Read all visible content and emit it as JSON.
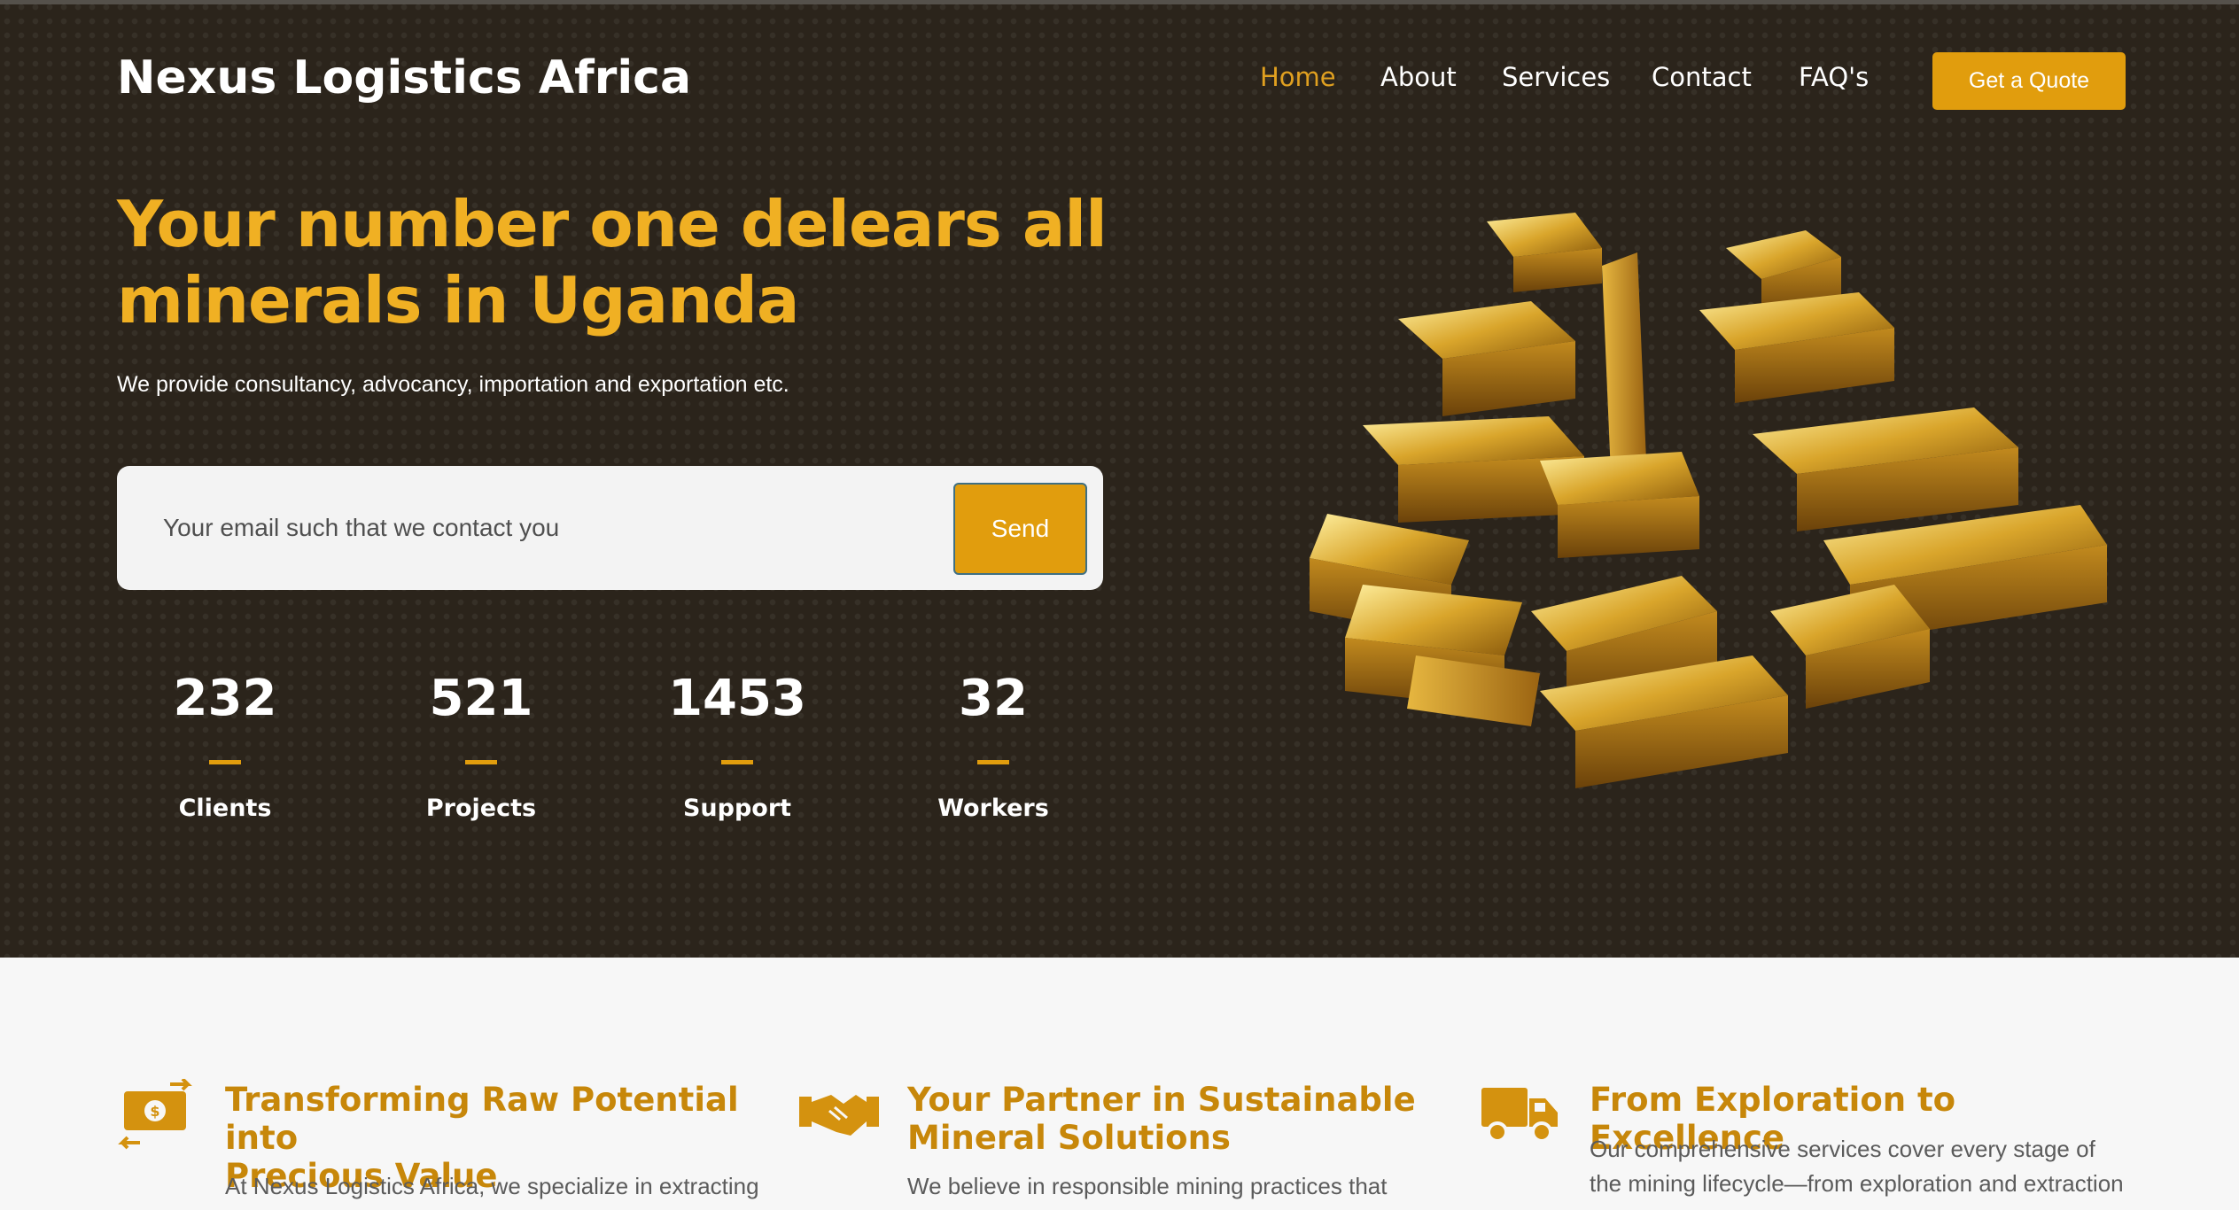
{
  "brand": {
    "name": "Nexus Logistics Africa"
  },
  "nav": {
    "items": [
      {
        "label": "Home",
        "active": true
      },
      {
        "label": "About",
        "active": false
      },
      {
        "label": "Services",
        "active": false
      },
      {
        "label": "Contact",
        "active": false
      },
      {
        "label": "FAQ's",
        "active": false
      }
    ],
    "cta_label": "Get a Quote"
  },
  "hero": {
    "headline_line1": "Your number one delears all",
    "headline_line2": "minerals in Uganda",
    "subtext": "We provide consultancy, advocancy, importation and exportation etc.",
    "email_placeholder": "Your email such that we contact you",
    "send_label": "Send",
    "image_icon": "gold-bars-image"
  },
  "stats": [
    {
      "value": "232",
      "label": "Clients"
    },
    {
      "value": "521",
      "label": "Projects"
    },
    {
      "value": "1453",
      "label": "Support"
    },
    {
      "value": "32",
      "label": "Workers"
    }
  ],
  "features": [
    {
      "icon": "money-exchange-icon",
      "title_line1": "Transforming Raw Potential into",
      "title_line2": "Precious Value",
      "text_line1": "At Nexus Logistics Africa, we specialize in extracting"
    },
    {
      "icon": "handshake-icon",
      "title_line1": "Your Partner in Sustainable",
      "title_line2": "Mineral Solutions",
      "text_line1": "We believe in responsible mining practices that"
    },
    {
      "icon": "truck-icon",
      "title_line1": "From Exploration to Excellence",
      "text_line1": "Our comprehensive services cover every stage of",
      "text_line2": "the mining lifecycle—from exploration and extraction"
    }
  ],
  "colors": {
    "accent": "#e19d0d",
    "headline": "#f0b023",
    "hero_bg": "#2b241b",
    "feature_title": "#c7870a"
  }
}
